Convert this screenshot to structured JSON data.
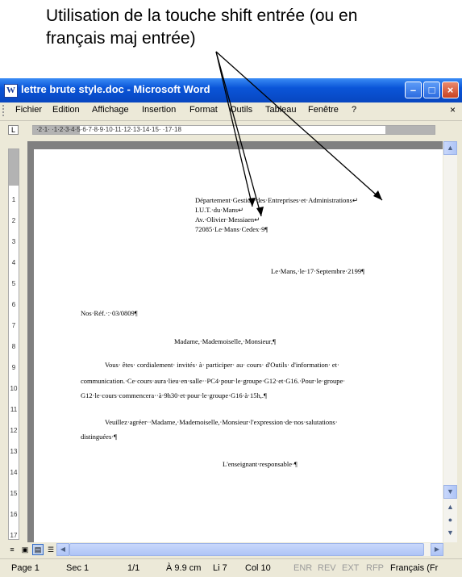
{
  "annotation": {
    "line1": "Utilisation de la touche shift entrée (ou en",
    "line2": "français maj entrée)"
  },
  "window": {
    "title": "lettre brute style.doc - Microsoft Word",
    "app_icon": "W"
  },
  "menu": [
    "Fichier",
    "Edition",
    "Affichage",
    "Insertion",
    "Format",
    "Outils",
    "Tableau",
    "Fenêtre",
    "?"
  ],
  "ruler": {
    "tab_button": "L",
    "horizontal": "·2·1· ·1·2·3·4·5·6·7·8·9·10·11·12·13·14·15· ·17·18",
    "vertical": [
      "2",
      "1",
      "1",
      "2",
      "3",
      "4",
      "5",
      "6",
      "7",
      "8",
      "9",
      "10",
      "11",
      "12",
      "13",
      "14",
      "15",
      "16",
      "17"
    ]
  },
  "document": {
    "address": [
      "Département·Gestion·des·Entreprises·et·Administrations↵",
      "I.U.T.·du·Mans↵",
      "Av.·Olivier·Messiaen↵",
      "72085·Le·Mans·Cedex·9¶"
    ],
    "date": "Le·Mans,·le·17·Septembre·2199¶",
    "reference": "Nos·Réf.·:·03/0809¶",
    "salutation": "Madame,·Mademoiselle,·Monsieur,¶",
    "body1": [
      "Vous·  êtes·  cordialement·  invités·  à·  participer·  au·  cours·  d'Outils·  d'information·  et·",
      "communication.·Ce·cours·aura·lieu·en·salle··PC4·pour·le·groupe·G12·et·G16.·Pour·le·groupe·",
      "G12·le·cours·commencera··à·9h30·et·pour·le·groupe·G16·à·15h,.¶"
    ],
    "body2": [
      "Veuillez·agréer··Madame,·Mademoiselle,·Monsieur·l'expression·de·nos·salutations·",
      "distinguées·¶"
    ],
    "signature": "L'enseignant·responsable·¶"
  },
  "status": {
    "page": "Page  1",
    "section": "Sec  1",
    "pages": "1/1",
    "at": "À  9.9 cm",
    "line": "Li  7",
    "col": "Col  10",
    "enr": "ENR",
    "rev": "REV",
    "ext": "EXT",
    "rfp": "RFP",
    "lang": "Français (Fr"
  },
  "colors": {
    "titlebar": "#0a55d8",
    "chrome": "#ece9d8",
    "doc_background": "#808080"
  },
  "icons": [
    "word-app-icon",
    "minimize-icon",
    "maximize-icon",
    "close-icon",
    "scroll-up-icon",
    "scroll-down-icon",
    "prev-page-icon",
    "browse-object-icon",
    "next-page-icon",
    "scroll-left-icon",
    "scroll-right-icon",
    "normal-view-icon",
    "web-view-icon",
    "print-view-icon",
    "outline-view-icon"
  ]
}
